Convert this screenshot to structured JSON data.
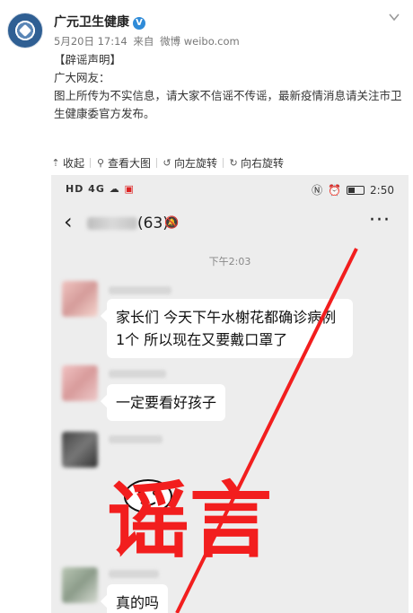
{
  "post": {
    "author": "广元卫生健康",
    "verified_badge": "V",
    "date": "5月20日 17:14",
    "source_prefix": "来自",
    "source": "微博 weibo.com",
    "tag": "【辟谣声明】",
    "greeting": "广大网友：",
    "body": "图上所传为不实信息，请大家不信谣不传谣，最新疫情消息请关注市卫生健康委官方发布。"
  },
  "toolbar": {
    "collapse": "收起",
    "view_large": "查看大图",
    "rotate_left": "向左旋转",
    "rotate_right": "向右旋转"
  },
  "phone": {
    "status_left": "HD 4G",
    "status_time": "2:50",
    "group_count": "(63)",
    "timestamp": "下午2:03",
    "messages": [
      "家长们 今天下午水榭花都确诊病例1个 所以现在又要戴口罩了",
      "一定要看好孩子",
      "真的吗"
    ],
    "stamp": "谣言",
    "stamp_color": "#f21e1e"
  },
  "icons": {
    "collapse": "collapse-icon",
    "view_large": "search-icon",
    "rotate_left": "rotate-left-icon",
    "rotate_right": "rotate-right-icon"
  }
}
